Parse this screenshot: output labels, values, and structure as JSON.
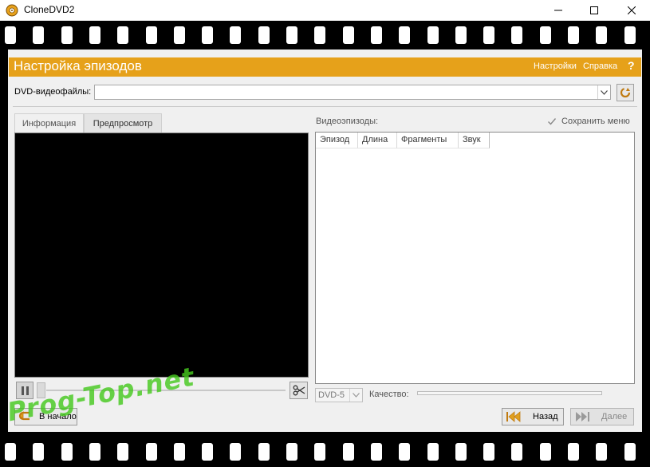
{
  "window": {
    "title": "CloneDVD2"
  },
  "header": {
    "title": "Настройка эпизодов",
    "settings_label": "Настройки",
    "help_label": "Справка",
    "help_glyph": "?"
  },
  "source": {
    "label": "DVD-видеофайлы:",
    "value": "",
    "placeholder": ""
  },
  "tabs": [
    {
      "label": "Информация",
      "active": false
    },
    {
      "label": "Предпросмотр",
      "active": true
    }
  ],
  "episodes": {
    "label": "Видеоэпизоды:",
    "save_menu_label": "Сохранить меню",
    "save_menu_checked": true,
    "columns": [
      "Эпизод",
      "Длина",
      "Фрагменты",
      "Звук"
    ],
    "rows": []
  },
  "output": {
    "disc_type": "DVD-5",
    "quality_label": "Качество:",
    "quality_value": 0
  },
  "player": {
    "seek_position": 0
  },
  "nav": {
    "start_label": "В начало",
    "back_label": "Назад",
    "next_label": "Далее",
    "next_enabled": false
  },
  "watermark": {
    "text": "Prog-Top.net"
  },
  "colors": {
    "accent": "#e6a11a",
    "film": "#000000",
    "watermark": "#46c81e"
  },
  "icons": {
    "app": "dvd-icon",
    "refresh": "refresh-icon",
    "pause": "pause-icon",
    "cut": "scissors-icon",
    "start": "return-arrow-icon",
    "back": "rewind-icon",
    "next": "skip-forward-icon"
  }
}
